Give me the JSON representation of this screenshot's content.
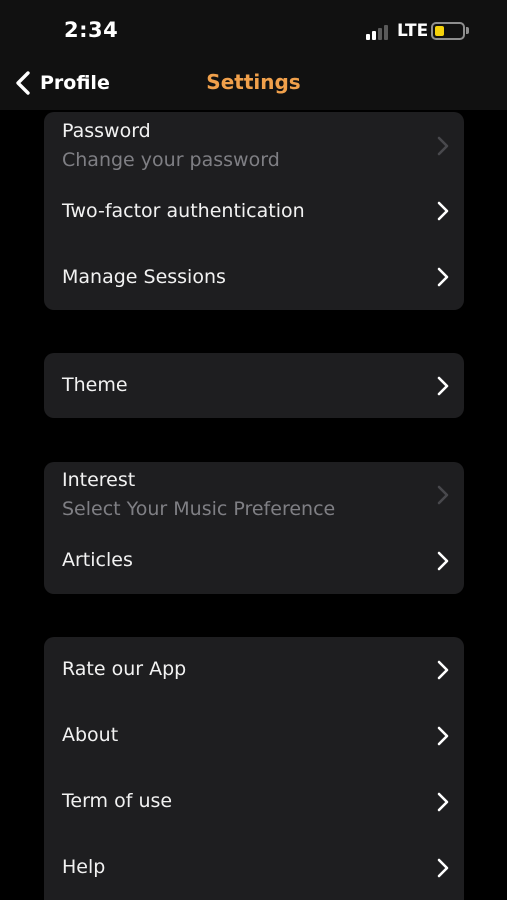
{
  "status_bar": {
    "time": "2:34",
    "network": "LTE",
    "signal_icon": "signal-bars-icon",
    "battery_icon": "battery-icon",
    "battery_level_fraction": 0.35,
    "battery_color": "#f5d20b"
  },
  "nav": {
    "back_icon": "chevron-left-icon",
    "back_label": "Profile",
    "title": "Settings",
    "title_color": "#f0a04b"
  },
  "groups": [
    {
      "items": [
        {
          "title": "Password",
          "subtitle": "Change your password",
          "icon": "chevron-right-icon"
        },
        {
          "title": "Two-factor authentication",
          "icon": "chevron-right-icon"
        },
        {
          "title": "Manage Sessions",
          "icon": "chevron-right-icon"
        }
      ]
    },
    {
      "items": [
        {
          "title": "Theme",
          "icon": "chevron-right-icon"
        }
      ]
    },
    {
      "items": [
        {
          "title": "Interest",
          "subtitle": "Select Your Music Preference",
          "icon": "chevron-right-icon"
        },
        {
          "title": "Articles",
          "icon": "chevron-right-icon"
        }
      ]
    },
    {
      "items": [
        {
          "title": "Rate our App",
          "icon": "chevron-right-icon"
        },
        {
          "title": "About",
          "icon": "chevron-right-icon"
        },
        {
          "title": "Term of use",
          "icon": "chevron-right-icon"
        },
        {
          "title": "Help",
          "icon": "chevron-right-icon"
        }
      ]
    }
  ]
}
